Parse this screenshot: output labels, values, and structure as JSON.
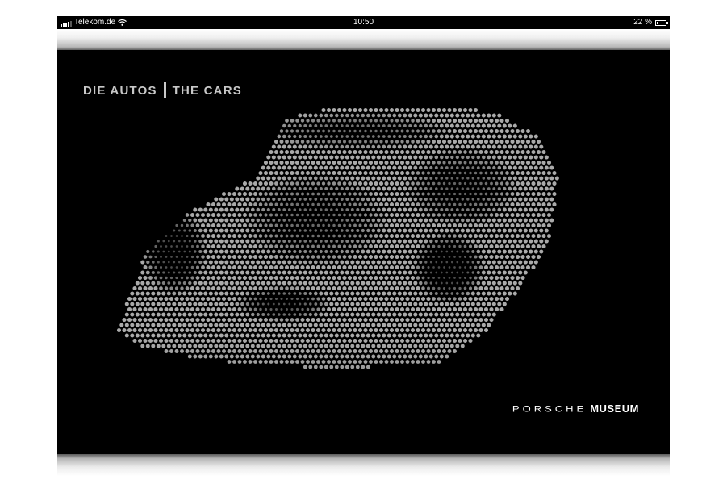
{
  "status_bar": {
    "carrier": "Telekom.de",
    "time": "10:50",
    "battery_text": "22 %",
    "battery_level": 0.22,
    "signal_bars": 4
  },
  "header": {
    "title_de": "DIE AUTOS",
    "title_en": "THE CARS"
  },
  "brand": {
    "porsche": "PORSCHE",
    "museum": "MUSEUM"
  },
  "colors": {
    "background": "#000000",
    "heading": "#c8c8c8",
    "dots": "#bdbdbd"
  }
}
